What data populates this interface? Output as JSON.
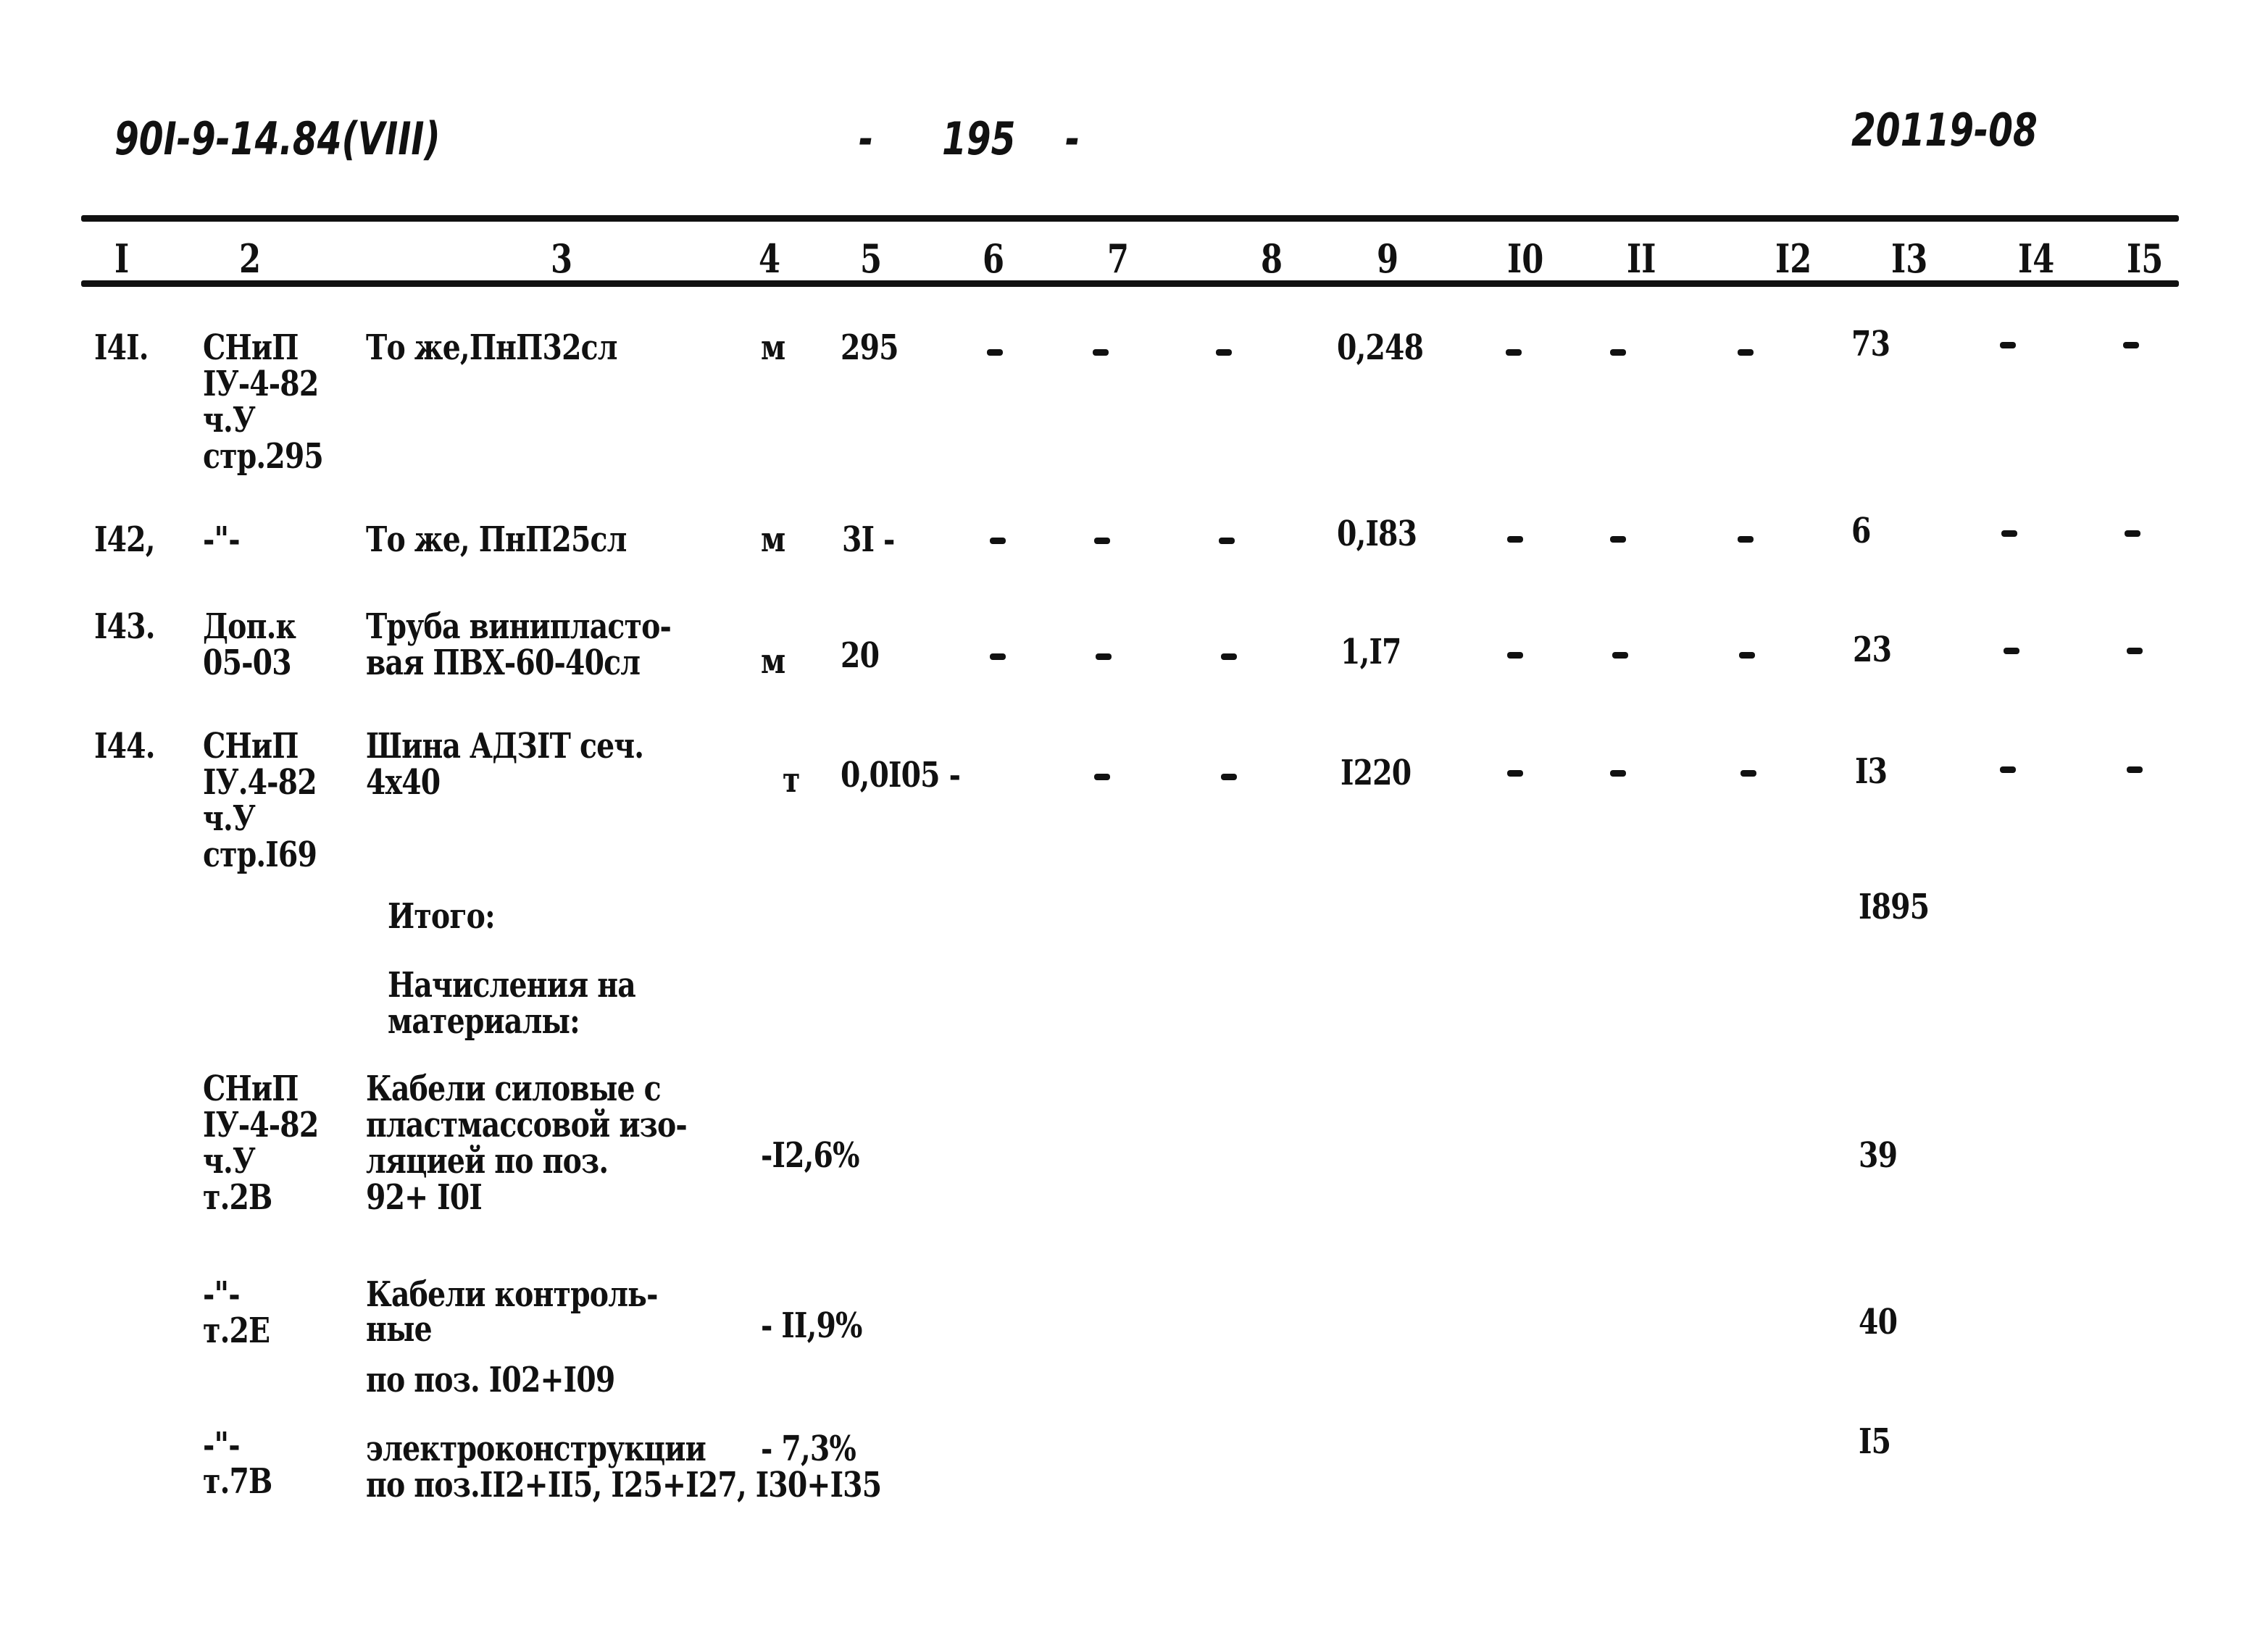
{
  "header": {
    "doc_code": "90I-9-14.84(VIII)",
    "page_number": "195",
    "inventory_number": "20119-08"
  },
  "table": {
    "columns": [
      "I",
      "2",
      "3",
      "4",
      "5",
      "6",
      "7",
      "8",
      "9",
      "I0",
      "II",
      "I2",
      "I3",
      "I4",
      "I5"
    ],
    "rows": [
      {
        "num": "I4I.",
        "ref": "СНиП\nIУ-4-82\nч.У\nстр.295",
        "name": "То же,ПнП32сл",
        "unit": "м",
        "qty": "295",
        "c6": "-",
        "c7": "-",
        "c8": "-",
        "c9": "0,248",
        "c10": "-",
        "c11": "-",
        "c12": "-",
        "c13": "73",
        "c14": "-",
        "c15": "-"
      },
      {
        "num": "I42,",
        "ref": "-\"-",
        "name": "То же, ПнП25сл",
        "unit": "м",
        "qty": "3I -",
        "c6": "-",
        "c7": "-",
        "c8": "-",
        "c9": "0,I83",
        "c10": "-",
        "c11": "-",
        "c12": "-",
        "c13": "6",
        "c14": "-",
        "c15": "-"
      },
      {
        "num": "I43.",
        "ref": "Доп.к\n05-03",
        "name": "Труба винипласто-\nвая ПВХ-60-40сл",
        "unit": "м",
        "qty": "20",
        "c6": "-",
        "c7": "-",
        "c8": "-",
        "c9": "1,I7",
        "c10": "-",
        "c11": "-",
        "c12": "-",
        "c13": "23",
        "c14": "-",
        "c15": "-"
      },
      {
        "num": "I44.",
        "ref": "СНиП\nIУ.4-82\nч.У\nстр.I69",
        "name": "Шина АДЗIТ сеч.\n4х40",
        "unit": "т",
        "qty": "0,0I05 -",
        "c6": "-",
        "c7": "-",
        "c8": "-",
        "c9": "I220",
        "c10": "-",
        "c11": "-",
        "c12": "-",
        "c13": "I3",
        "c14": "-",
        "c15": "-"
      }
    ],
    "total": {
      "label": "Итого:",
      "value": "I895"
    },
    "accruals_heading": "Начисления на\nматериалы:",
    "accruals": [
      {
        "ref": "СНиП\nIУ-4-82\nч.У\nт.2В",
        "name": "Кабели силовые с\nпластмассовой изо-\nляцией по поз.\n92+ I0I",
        "rate": "-I2,6%",
        "value": "39"
      },
      {
        "ref": "-\"-\nт.2Е",
        "name": "Кабели контроль-\nные\nпо поз. I02+I09",
        "rate": "- II,9%",
        "value": "40"
      },
      {
        "ref": "-\"-\nт.7В",
        "name": "электроконструкции\nпо поз.II2+II5, I25+I27, I30+I35",
        "rate": "- 7,3%",
        "value": "I5"
      }
    ]
  }
}
